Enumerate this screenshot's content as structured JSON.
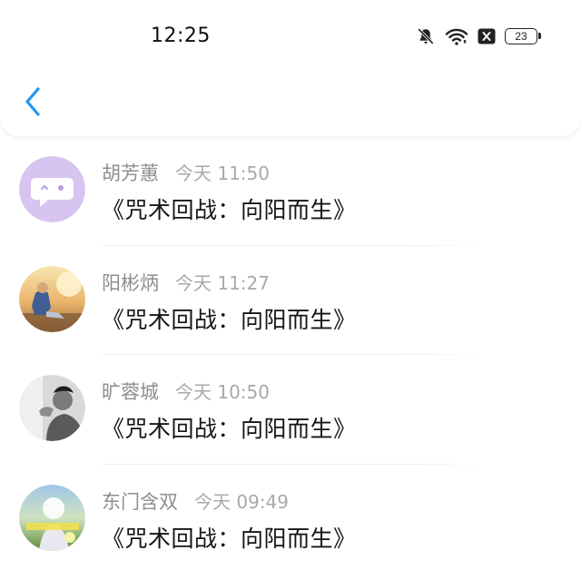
{
  "status_bar": {
    "time": "12:25",
    "battery": "23",
    "icons": [
      "bell-muted-icon",
      "wifi-icon",
      "sim-blocked-icon",
      "battery-icon"
    ]
  },
  "nav": {
    "back_icon": "chevron-left-icon",
    "accent_color": "#2196F3"
  },
  "messages": [
    {
      "name": "胡芳蕙",
      "time": "今天 11:50",
      "text": "《咒术回战：向阳而生》",
      "avatar": "chat-bubble-avatar"
    },
    {
      "name": "阳彬炳",
      "time": "今天 11:27",
      "text": "《咒术回战：向阳而生》",
      "avatar": "autumn-photo-avatar"
    },
    {
      "name": "旷蓉城",
      "time": "今天 10:50",
      "text": "《咒术回战：向阳而生》",
      "avatar": "monochrome-portrait-avatar"
    },
    {
      "name": "东门含双",
      "time": "今天 09:49",
      "text": "《咒术回战：向阳而生》",
      "avatar": "photo-avatar"
    }
  ]
}
